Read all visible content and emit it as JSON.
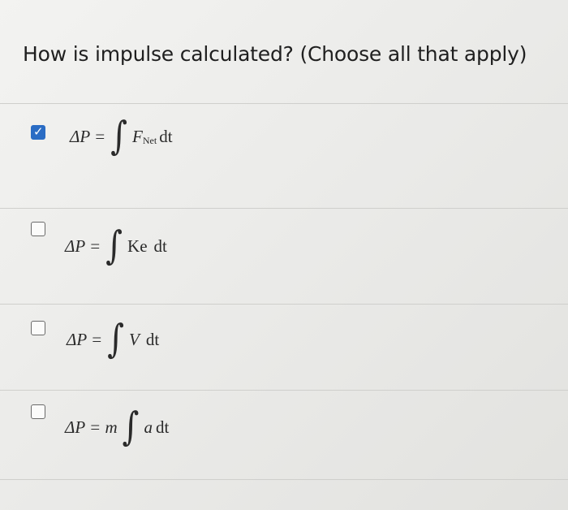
{
  "question": {
    "text": "How is impulse calculated? (Choose all that apply)"
  },
  "options": [
    {
      "checked": true,
      "lhs": "ΔP =",
      "integral": "∫",
      "integrand": "F",
      "subscript": "Net",
      "differential": "dt"
    },
    {
      "checked": false,
      "lhs": "ΔP =",
      "integral": "∫",
      "integrand": "Ke",
      "differential": "dt"
    },
    {
      "checked": false,
      "lhs": "ΔP =",
      "integral": "∫",
      "integrand": "V",
      "differential": "dt"
    },
    {
      "checked": false,
      "lhs": "ΔP = m",
      "integral": "∫",
      "integrand": "a",
      "differential": "dt"
    }
  ],
  "colors": {
    "checkbox_checked": "#2a6cc4",
    "checkbox_border": "#6a6a6a"
  },
  "icons": {
    "checked_checkbox": "checkmark-icon"
  }
}
